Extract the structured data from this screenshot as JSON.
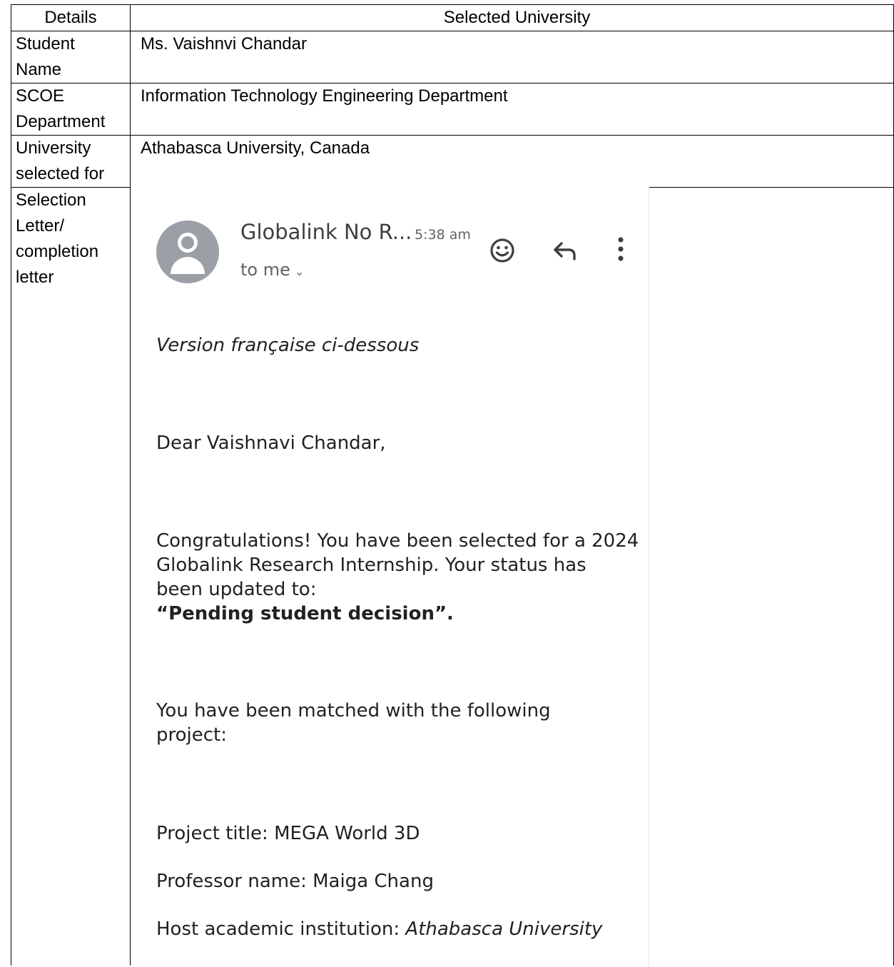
{
  "table": {
    "header": {
      "details": "Details",
      "selected_university": "Selected University"
    },
    "rows": [
      {
        "label_lines": [
          "Student",
          "Name"
        ],
        "value": "Ms. Vaishnvi Chandar"
      },
      {
        "label_lines": [
          "SCOE",
          "Department"
        ],
        "value": "Information Technology Engineering Department"
      },
      {
        "label_lines": [
          "University",
          "selected for"
        ],
        "value": "Athabasca University, Canada"
      },
      {
        "label_lines": [
          "Selection",
          "Letter/",
          "completion",
          "letter"
        ],
        "value": ""
      }
    ]
  },
  "email": {
    "sender": "Globalink No R...",
    "time": "5:38 am",
    "recipient": "to me",
    "icons": [
      "avatar-icon",
      "emoji-icon",
      "reply-icon",
      "more-icon",
      "chevron-down-icon"
    ],
    "lines": {
      "version_note": "Version française ci-dessous",
      "greeting": "Dear Vaishnavi Chandar,",
      "congrats_1": "Congratulations! You have been selected for a 2024",
      "congrats_2": "Globalink Research Internship. Your status has",
      "congrats_3": "been updated to:",
      "status": "“Pending student decision”.",
      "matched_1": "You have been matched with the following",
      "matched_2": "project:",
      "project_title": "Project title: MEGA World 3D",
      "professor": "Professor name: Maiga Chang",
      "host_label": "Host academic institution: ",
      "host_value": "Athabasca University"
    }
  }
}
